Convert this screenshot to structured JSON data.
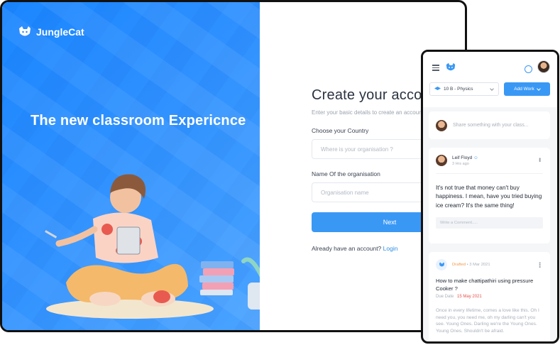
{
  "desktop": {
    "brand": "JungleCat",
    "hero_title": "The new classroom Expericnce",
    "form": {
      "title": "Create your account",
      "subtitle": "Enter your basic details to create an account",
      "country_label": "Choose your Country",
      "country_placeholder": "Where is your organisation ?",
      "org_label": "Name Of the organisation",
      "org_placeholder": "Organisation name",
      "next_label": "Next",
      "login_prompt": "Already have an  account?",
      "login_link": "Login"
    }
  },
  "mobile": {
    "class_select": "10 B - Physics",
    "add_work_label": "Add Work",
    "share_placeholder": "Share something with your class...",
    "post": {
      "author": "Leif Floyd",
      "time": "3 Hrs ago",
      "body": "It's not true that money can't buy happiness. I mean, have you tried buying ice cream? It's the same thing!",
      "comment_placeholder": "Write a Comment....."
    },
    "assignment": {
      "status": "Drafted",
      "date": "• 3 Mar 2021",
      "title": "How to make chattipathiri using pressure Cooker ?",
      "due_label": "Due Date",
      "due_date": "15 May 2021",
      "description": "Once in every lifetime, comes a love like this. Oh I need you, you need me, oh my darling can't you see. Young Ones. Darling we're the Young Ones. Young Ones. Shouldn't be afraid."
    }
  },
  "colors": {
    "primary": "#3a98f5",
    "hero_blue": "#1a86ff",
    "drafted": "#f2994a",
    "due": "#e5534b"
  }
}
